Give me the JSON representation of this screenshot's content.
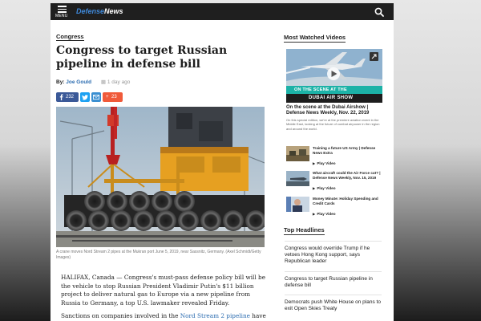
{
  "header": {
    "menu_label": "MENU",
    "logo_part1": "Defense",
    "logo_part2": "News"
  },
  "article": {
    "section": "Congress",
    "headline": "Congress to target Russian pipeline in defense bill",
    "by_label": "By:",
    "author": "Joe Gould",
    "time_ago": "1 day ago",
    "share": {
      "facebook_count": "232",
      "more_count": "23"
    },
    "caption": "A crane moves Nord Stream 2 pipes at the Mukran port June 5, 2019, near Sassnitz, Germany. (Axel Schmidt/Getty Images)",
    "paragraph1": "HALIFAX, Canada — Congress's must-pass defense policy bill will be the vehicle to stop Russian President Vladimir Putin's $11 billion project to deliver natural gas to Europe via a new pipeline from Russia to Germany, a top U.S. lawmaker revealed Friday.",
    "paragraph2_prefix": "Sanctions on companies involved in the ",
    "paragraph2_link": "Nord Stream 2 pipeline",
    "paragraph2_suffix": " have been"
  },
  "sidebar": {
    "most_watched_title": "Most Watched Videos",
    "feature": {
      "banner_line1": "ON THE SCENE AT THE",
      "banner_line2": "DUBAI AIR SHOW",
      "title": "On the scene at the Dubai Airshow | Defense News Weekly, Nov. 22, 2019",
      "description": "On this special edition, we're at the premiere aviation event in the Middle East, looking at the future of combat airpower in the region and around the world."
    },
    "videos": [
      {
        "title": "Training a future US Army | Defense News Extra",
        "play_label": "Play Video"
      },
      {
        "title": "What aircraft could the Air Force cut? | Defense News Weekly, Nov. 15, 2019",
        "play_label": "Play Video"
      },
      {
        "title": "Money Minute: Holiday Spending and Credit Cards",
        "play_label": "Play Video"
      }
    ],
    "top_headlines_title": "Top Headlines",
    "headlines": [
      "Congress would override Trump if he vetoes Hong Kong support, says Republican leader",
      "Congress to target Russian pipeline in defense bill",
      "Democrats push White House on plans to exit Open Skies Treaty"
    ]
  },
  "colors": {
    "topbar": "#1f1f1f",
    "logo_accent": "#3f88d8",
    "link": "#2b6cb0",
    "facebook": "#3b5998",
    "twitter": "#1da1f2",
    "email": "#3a8fd1",
    "more": "#f05a3a"
  }
}
